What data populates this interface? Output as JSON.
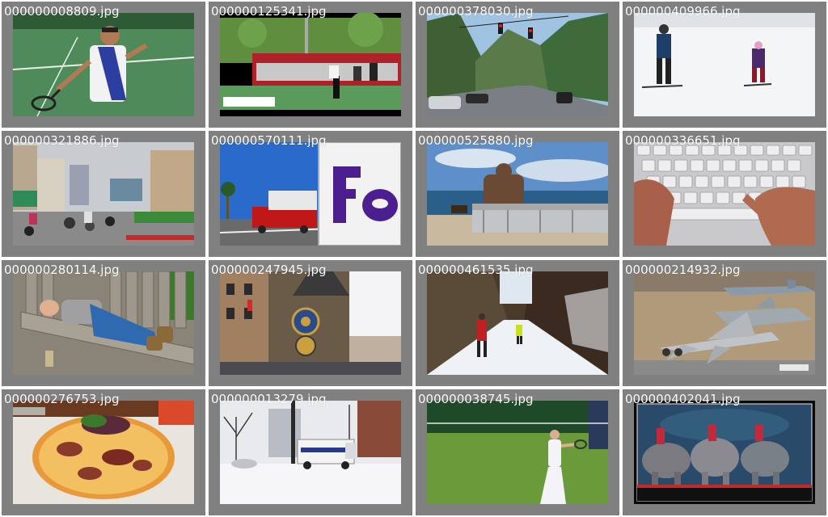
{
  "gallery": {
    "images": [
      {
        "filename": "000000008809.jpg",
        "subject": "tennis-player"
      },
      {
        "filename": "000000125341.jpg",
        "subject": "tennis-court-broadcast"
      },
      {
        "filename": "000000378030.jpg",
        "subject": "street-with-traffic-light"
      },
      {
        "filename": "000000409966.jpg",
        "subject": "skiers-on-snow"
      },
      {
        "filename": "000000321886.jpg",
        "subject": "busy-city-street"
      },
      {
        "filename": "000000570111.jpg",
        "subject": "fedex-truck"
      },
      {
        "filename": "000000525880.jpg",
        "subject": "statue-on-bench-by-sea"
      },
      {
        "filename": "000000336651.jpg",
        "subject": "hands-on-keyboard"
      },
      {
        "filename": "000000280114.jpg",
        "subject": "man-sleeping-on-bench"
      },
      {
        "filename": "000000247945.jpg",
        "subject": "astronomical-clock"
      },
      {
        "filename": "000000461535.jpg",
        "subject": "cross-country-skiers"
      },
      {
        "filename": "000000214932.jpg",
        "subject": "fighter-jets"
      },
      {
        "filename": "000000276753.jpg",
        "subject": "pizza"
      },
      {
        "filename": "000000013279.jpg",
        "subject": "snowy-street-truck"
      },
      {
        "filename": "000000038745.jpg",
        "subject": "tennis-player-grass"
      },
      {
        "filename": "000000402041.jpg",
        "subject": "circus-elephants"
      }
    ]
  }
}
